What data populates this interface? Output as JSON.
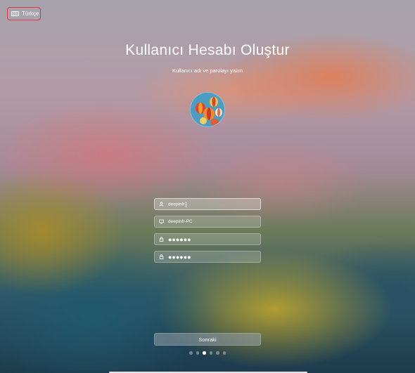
{
  "language": {
    "label": "Türkçe",
    "icon": "keyboard-icon"
  },
  "header": {
    "title": "Kullanıcı Hesabı Oluştur",
    "subtitle": "Kullanıcı adı ve parolayı yazın"
  },
  "avatar": {
    "icon": "hot-air-balloons-avatar"
  },
  "form": {
    "username": {
      "icon": "user-icon",
      "value": "deepinfr"
    },
    "hostname": {
      "icon": "monitor-icon",
      "value": "deepinfr-PC"
    },
    "password": {
      "icon": "lock-icon",
      "value": "●●●●●●"
    },
    "password_repeat": {
      "icon": "lock-icon",
      "value": "●●●●●●"
    }
  },
  "next_button": {
    "label": "Sonraki"
  },
  "pager": {
    "total": 6,
    "current": 3
  },
  "colors": {
    "focus_outline": "#e0364a",
    "text": "#ffffff"
  }
}
